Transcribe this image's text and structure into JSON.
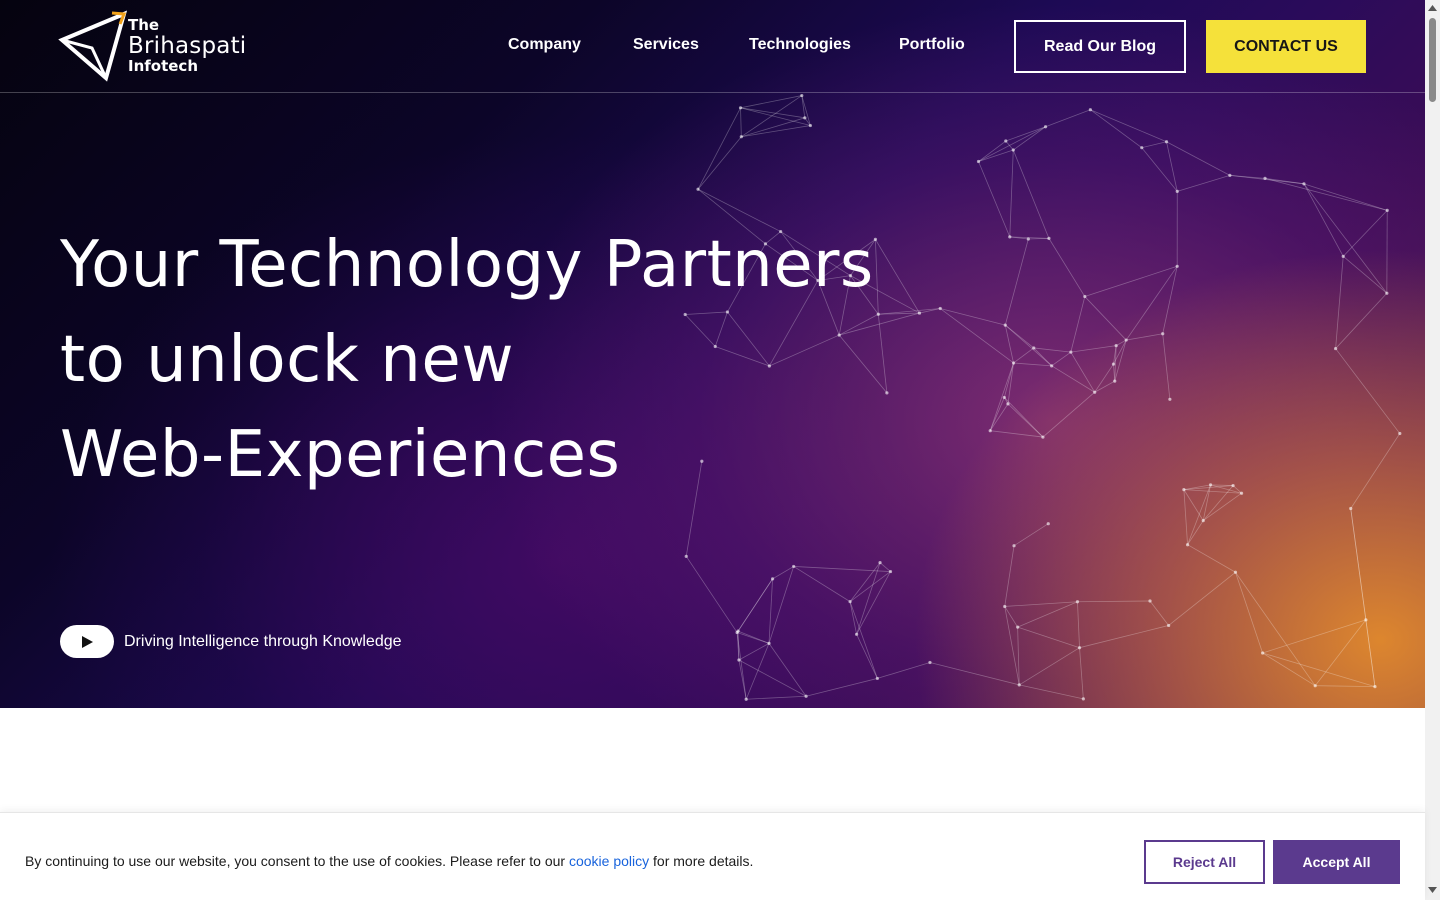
{
  "header": {
    "logo": {
      "line1": "The",
      "line2": "Brihaspati",
      "line3": "Infotech"
    },
    "nav": [
      {
        "label": "Company"
      },
      {
        "label": "Services"
      },
      {
        "label": "Technologies"
      },
      {
        "label": "Portfolio"
      }
    ],
    "blog_button": "Read Our Blog",
    "contact_button": "CONTACT US"
  },
  "hero": {
    "headline_lines": [
      "Your Technology Partners",
      "to unlock new",
      "Web-Experiences"
    ],
    "tagline": "Driving Intelligence through Knowledge",
    "play_icon": "play-icon"
  },
  "cookie_banner": {
    "text_before": "By continuing to use our website, you consent to the use of cookies. Please refer to our ",
    "link_text": "cookie policy",
    "text_after": " for more details.",
    "reject_label": "Reject All",
    "accept_label": "Accept All"
  },
  "colors": {
    "contact_bg": "#f5e13a",
    "cookie_button": "#5b3a8e",
    "cookie_link": "#1863dc",
    "hero_dark": "#0c0528",
    "hero_orange": "#e48c2c"
  }
}
